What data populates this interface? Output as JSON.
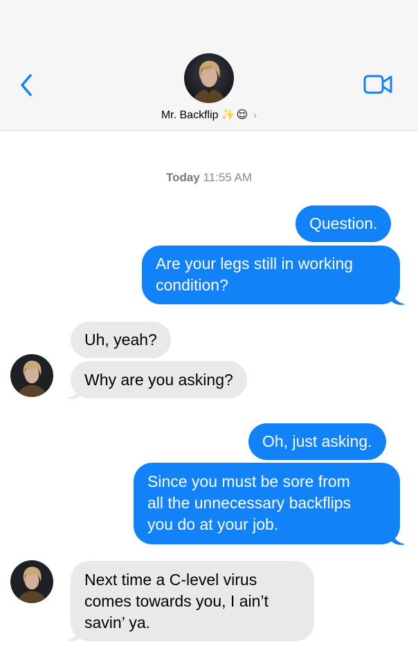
{
  "header": {
    "contact_name": "Mr. Backflip",
    "contact_emoji": [
      "✨",
      "😌"
    ],
    "chevron": "›",
    "back_icon": "chevron-left-icon",
    "video_icon": "video-camera-icon"
  },
  "thread": {
    "timestamp_day": "Today",
    "timestamp_time": "11:55 AM",
    "messages": [
      {
        "sender": "me",
        "text": "Question."
      },
      {
        "sender": "me",
        "text": "Are your legs still in working\ncondition?"
      },
      {
        "sender": "them",
        "text": "Uh, yeah?"
      },
      {
        "sender": "them",
        "text": "Why are you asking?"
      },
      {
        "sender": "me",
        "text": "Oh, just asking."
      },
      {
        "sender": "me",
        "text": "Since you must be sore from\nall the unnecessary backflips\nyou do at your job."
      },
      {
        "sender": "them",
        "text": "Next time a C-level virus\ncomes towards you, I ain’t\nsavin’ ya."
      }
    ]
  },
  "colors": {
    "outgoing_bubble": "#1282f9",
    "incoming_bubble": "#e9e9eb",
    "accent": "#1282f9",
    "header_bg": "#f6f6f6"
  }
}
